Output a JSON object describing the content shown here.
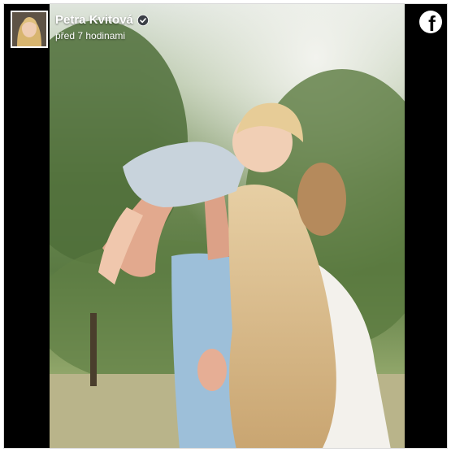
{
  "post": {
    "author_name": "Petra Kvitová",
    "verified": true,
    "timestamp": "před 7 hodinami",
    "platform_icon": "facebook-logo-icon",
    "facebook_glyph": "f"
  },
  "colors": {
    "frame_background": "#000000",
    "header_text": "#ffffff",
    "facebook_badge": "#ffffff"
  }
}
